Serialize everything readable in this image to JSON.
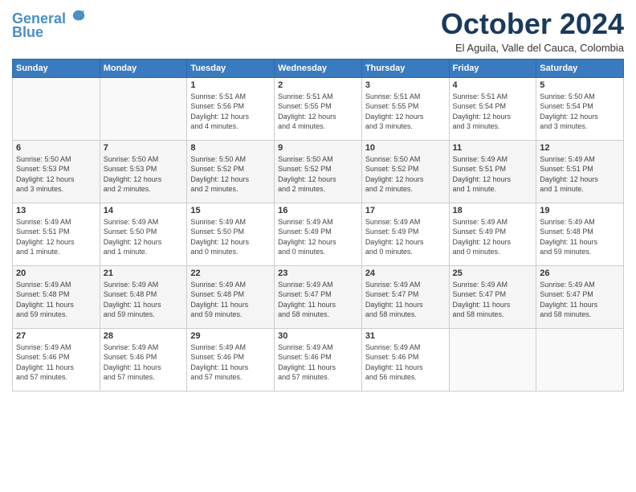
{
  "header": {
    "logo_line1": "General",
    "logo_line2": "Blue",
    "month": "October 2024",
    "location": "El Aguila, Valle del Cauca, Colombia"
  },
  "weekdays": [
    "Sunday",
    "Monday",
    "Tuesday",
    "Wednesday",
    "Thursday",
    "Friday",
    "Saturday"
  ],
  "weeks": [
    [
      {
        "day": "",
        "info": ""
      },
      {
        "day": "",
        "info": ""
      },
      {
        "day": "1",
        "info": "Sunrise: 5:51 AM\nSunset: 5:56 PM\nDaylight: 12 hours\nand 4 minutes."
      },
      {
        "day": "2",
        "info": "Sunrise: 5:51 AM\nSunset: 5:55 PM\nDaylight: 12 hours\nand 4 minutes."
      },
      {
        "day": "3",
        "info": "Sunrise: 5:51 AM\nSunset: 5:55 PM\nDaylight: 12 hours\nand 3 minutes."
      },
      {
        "day": "4",
        "info": "Sunrise: 5:51 AM\nSunset: 5:54 PM\nDaylight: 12 hours\nand 3 minutes."
      },
      {
        "day": "5",
        "info": "Sunrise: 5:50 AM\nSunset: 5:54 PM\nDaylight: 12 hours\nand 3 minutes."
      }
    ],
    [
      {
        "day": "6",
        "info": "Sunrise: 5:50 AM\nSunset: 5:53 PM\nDaylight: 12 hours\nand 3 minutes."
      },
      {
        "day": "7",
        "info": "Sunrise: 5:50 AM\nSunset: 5:53 PM\nDaylight: 12 hours\nand 2 minutes."
      },
      {
        "day": "8",
        "info": "Sunrise: 5:50 AM\nSunset: 5:52 PM\nDaylight: 12 hours\nand 2 minutes."
      },
      {
        "day": "9",
        "info": "Sunrise: 5:50 AM\nSunset: 5:52 PM\nDaylight: 12 hours\nand 2 minutes."
      },
      {
        "day": "10",
        "info": "Sunrise: 5:50 AM\nSunset: 5:52 PM\nDaylight: 12 hours\nand 2 minutes."
      },
      {
        "day": "11",
        "info": "Sunrise: 5:49 AM\nSunset: 5:51 PM\nDaylight: 12 hours\nand 1 minute."
      },
      {
        "day": "12",
        "info": "Sunrise: 5:49 AM\nSunset: 5:51 PM\nDaylight: 12 hours\nand 1 minute."
      }
    ],
    [
      {
        "day": "13",
        "info": "Sunrise: 5:49 AM\nSunset: 5:51 PM\nDaylight: 12 hours\nand 1 minute."
      },
      {
        "day": "14",
        "info": "Sunrise: 5:49 AM\nSunset: 5:50 PM\nDaylight: 12 hours\nand 1 minute."
      },
      {
        "day": "15",
        "info": "Sunrise: 5:49 AM\nSunset: 5:50 PM\nDaylight: 12 hours\nand 0 minutes."
      },
      {
        "day": "16",
        "info": "Sunrise: 5:49 AM\nSunset: 5:49 PM\nDaylight: 12 hours\nand 0 minutes."
      },
      {
        "day": "17",
        "info": "Sunrise: 5:49 AM\nSunset: 5:49 PM\nDaylight: 12 hours\nand 0 minutes."
      },
      {
        "day": "18",
        "info": "Sunrise: 5:49 AM\nSunset: 5:49 PM\nDaylight: 12 hours\nand 0 minutes."
      },
      {
        "day": "19",
        "info": "Sunrise: 5:49 AM\nSunset: 5:48 PM\nDaylight: 11 hours\nand 59 minutes."
      }
    ],
    [
      {
        "day": "20",
        "info": "Sunrise: 5:49 AM\nSunset: 5:48 PM\nDaylight: 11 hours\nand 59 minutes."
      },
      {
        "day": "21",
        "info": "Sunrise: 5:49 AM\nSunset: 5:48 PM\nDaylight: 11 hours\nand 59 minutes."
      },
      {
        "day": "22",
        "info": "Sunrise: 5:49 AM\nSunset: 5:48 PM\nDaylight: 11 hours\nand 59 minutes."
      },
      {
        "day": "23",
        "info": "Sunrise: 5:49 AM\nSunset: 5:47 PM\nDaylight: 11 hours\nand 58 minutes."
      },
      {
        "day": "24",
        "info": "Sunrise: 5:49 AM\nSunset: 5:47 PM\nDaylight: 11 hours\nand 58 minutes."
      },
      {
        "day": "25",
        "info": "Sunrise: 5:49 AM\nSunset: 5:47 PM\nDaylight: 11 hours\nand 58 minutes."
      },
      {
        "day": "26",
        "info": "Sunrise: 5:49 AM\nSunset: 5:47 PM\nDaylight: 11 hours\nand 58 minutes."
      }
    ],
    [
      {
        "day": "27",
        "info": "Sunrise: 5:49 AM\nSunset: 5:46 PM\nDaylight: 11 hours\nand 57 minutes."
      },
      {
        "day": "28",
        "info": "Sunrise: 5:49 AM\nSunset: 5:46 PM\nDaylight: 11 hours\nand 57 minutes."
      },
      {
        "day": "29",
        "info": "Sunrise: 5:49 AM\nSunset: 5:46 PM\nDaylight: 11 hours\nand 57 minutes."
      },
      {
        "day": "30",
        "info": "Sunrise: 5:49 AM\nSunset: 5:46 PM\nDaylight: 11 hours\nand 57 minutes."
      },
      {
        "day": "31",
        "info": "Sunrise: 5:49 AM\nSunset: 5:46 PM\nDaylight: 11 hours\nand 56 minutes."
      },
      {
        "day": "",
        "info": ""
      },
      {
        "day": "",
        "info": ""
      }
    ]
  ]
}
